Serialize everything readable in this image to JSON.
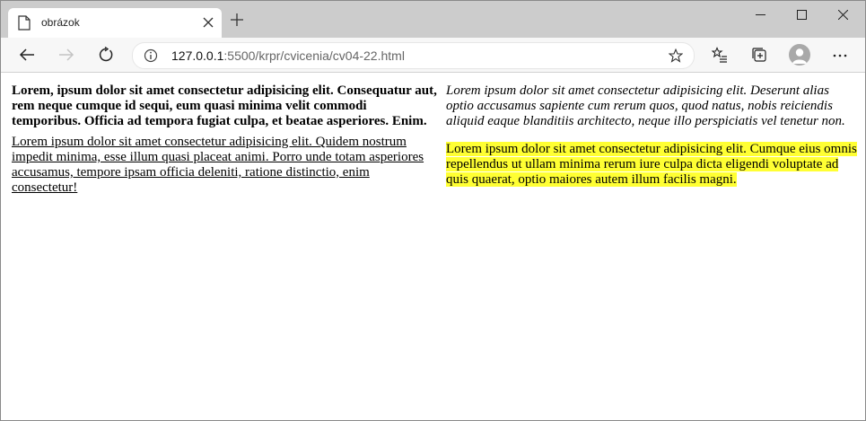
{
  "tab": {
    "title": "obrázok"
  },
  "address_bar": {
    "host": "127.0.0.1",
    "rest": ":5500/krpr/cvicenia/cv04-22.html"
  },
  "content": {
    "left": {
      "bold_paragraph": "Lorem, ipsum dolor sit amet consectetur adipisicing elit. Consequatur aut, rem neque cumque id sequi, eum quasi minima velit commodi temporibus. Officia ad tempora fugiat culpa, et beatae asperiores. Enim.",
      "underlined_paragraph": "Lorem ipsum dolor sit amet consectetur adipisicing elit. Quidem nostrum impedit minima, esse illum quasi placeat animi. Porro unde totam asperiores accusamus, tempore ipsam officia deleniti, ratione distinctio, enim consectetur!"
    },
    "right": {
      "italic_paragraph": "Lorem ipsum dolor sit amet consectetur adipisicing elit. Deserunt alias optio accusamus sapiente cum rerum quos, quod natus, nobis reiciendis aliquid eaque blanditiis architecto, neque illo perspiciatis vel tenetur non.",
      "highlighted_paragraph": "Lorem ipsum dolor sit amet consectetur adipisicing elit. Cumque eius omnis repellendus ut ullam minima rerum iure culpa dicta eligendi voluptate ad quis quaerat, optio maiores autem illum facilis magni."
    }
  },
  "colors": {
    "highlight": "#ffff33",
    "tabstrip": "#cccccc",
    "toolbar": "#f7f7f7"
  },
  "icons": [
    "document-icon",
    "close-icon",
    "new-tab-icon",
    "minimize-icon",
    "maximize-icon",
    "window-close-icon",
    "back-icon",
    "forward-icon",
    "refresh-icon",
    "info-icon",
    "favorite-star-icon",
    "favorites-list-icon",
    "collections-icon",
    "profile-icon",
    "more-icon"
  ]
}
